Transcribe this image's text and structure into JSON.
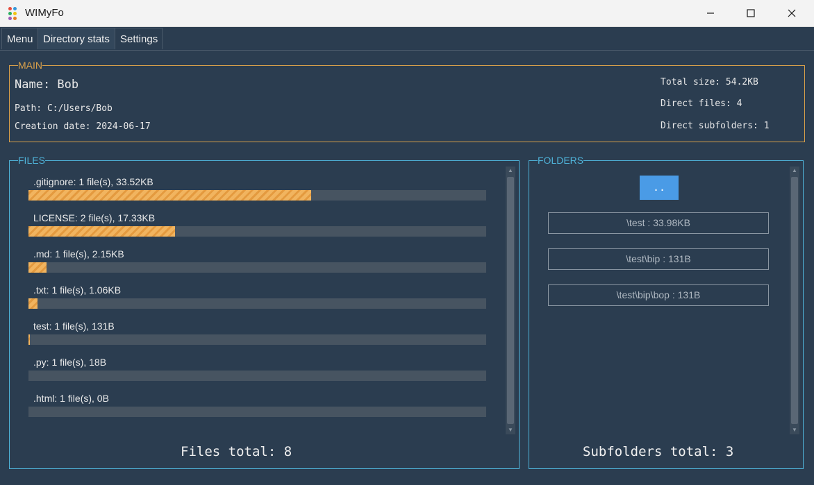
{
  "window": {
    "title": "WIMyFo",
    "minimize_glyph": "—",
    "maximize_glyph": "☐",
    "close_glyph": "✕"
  },
  "tabs": [
    {
      "label": "Menu"
    },
    {
      "label": "Directory stats"
    },
    {
      "label": "Settings"
    }
  ],
  "main": {
    "legend": "MAIN",
    "name_line": "Name: Bob",
    "path_line": "Path: C:/Users/Bob",
    "creation_line": "Creation date: 2024-06-17",
    "total_size_line": "Total size: 54.2KB",
    "direct_files_line": "Direct files: 4",
    "direct_subfolders_line": "Direct subfolders: 1"
  },
  "files": {
    "legend": "FILES",
    "items": [
      {
        "label": ".gitignore:  1 file(s),  33.52KB",
        "fill_pct": 61.8
      },
      {
        "label": "LICENSE:  2 file(s),  17.33KB",
        "fill_pct": 32.0
      },
      {
        "label": ".md:  1 file(s),  2.15KB",
        "fill_pct": 4.0
      },
      {
        "label": ".txt:  1 file(s),  1.06KB",
        "fill_pct": 2.0
      },
      {
        "label": "test:  1 file(s),  131B",
        "fill_pct": 0.3
      },
      {
        "label": ".py:  1 file(s),  18B",
        "fill_pct": 0
      },
      {
        "label": ".html:  1 file(s),  0B",
        "fill_pct": 0
      }
    ],
    "total_line": "Files total: 8"
  },
  "folders": {
    "legend": "FOLDERS",
    "up_label": "..",
    "items": [
      {
        "label": "\\test : 33.98KB"
      },
      {
        "label": "\\test\\bip : 131B"
      },
      {
        "label": "\\test\\bip\\bop : 131B"
      }
    ],
    "total_line": "Subfolders total: 3"
  },
  "colors": {
    "background": "#2b3d50",
    "main_border": "#d9a04a",
    "panel_border": "#4fb3d9",
    "bar_fill": "#f1b45f",
    "bar_track": "#475461",
    "up_button": "#4a9be6"
  },
  "icons": {
    "app": "app-dots-icon",
    "minimize": "minimize-icon",
    "maximize": "maximize-icon",
    "close": "close-icon",
    "scroll_up": "scroll-up-arrow-icon",
    "scroll_down": "scroll-down-arrow-icon"
  }
}
